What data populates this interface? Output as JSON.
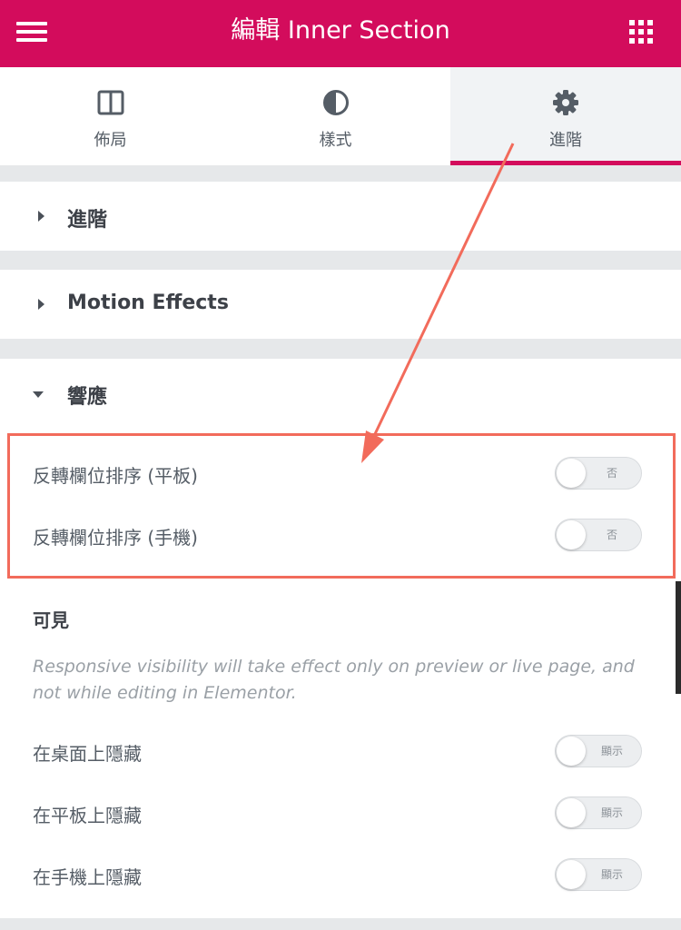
{
  "header": {
    "title": "編輯 Inner Section",
    "menu_icon": "hamburger-menu-icon",
    "apps_icon": "grid-apps-icon",
    "bg_color": "#d30c5c"
  },
  "tabs": [
    {
      "label": "佈局",
      "icon": "columns-layout-icon"
    },
    {
      "label": "樣式",
      "icon": "half-circle-style-icon"
    },
    {
      "label": "進階",
      "icon": "gear-icon",
      "active": true
    }
  ],
  "sections": {
    "advanced": {
      "title": "進階"
    },
    "motion": {
      "title": "Motion Effects"
    },
    "responsive": {
      "title": "響應",
      "reverse_tablet": {
        "label": "反轉欄位排序 (平板)",
        "toggle": "否"
      },
      "reverse_mobile": {
        "label": "反轉欄位排序 (手機)",
        "toggle": "否"
      },
      "visibility_heading": "可見",
      "visibility_note": "Responsive visibility will take effect only on preview or live page, and not while editing in Elementor.",
      "hide_desktop": {
        "label": "在桌面上隱藏",
        "toggle": "顯示"
      },
      "hide_tablet": {
        "label": "在平板上隱藏",
        "toggle": "顯示"
      },
      "hide_mobile": {
        "label": "在手機上隱藏",
        "toggle": "顯示"
      }
    }
  },
  "annotation_color": "#f26b5b"
}
